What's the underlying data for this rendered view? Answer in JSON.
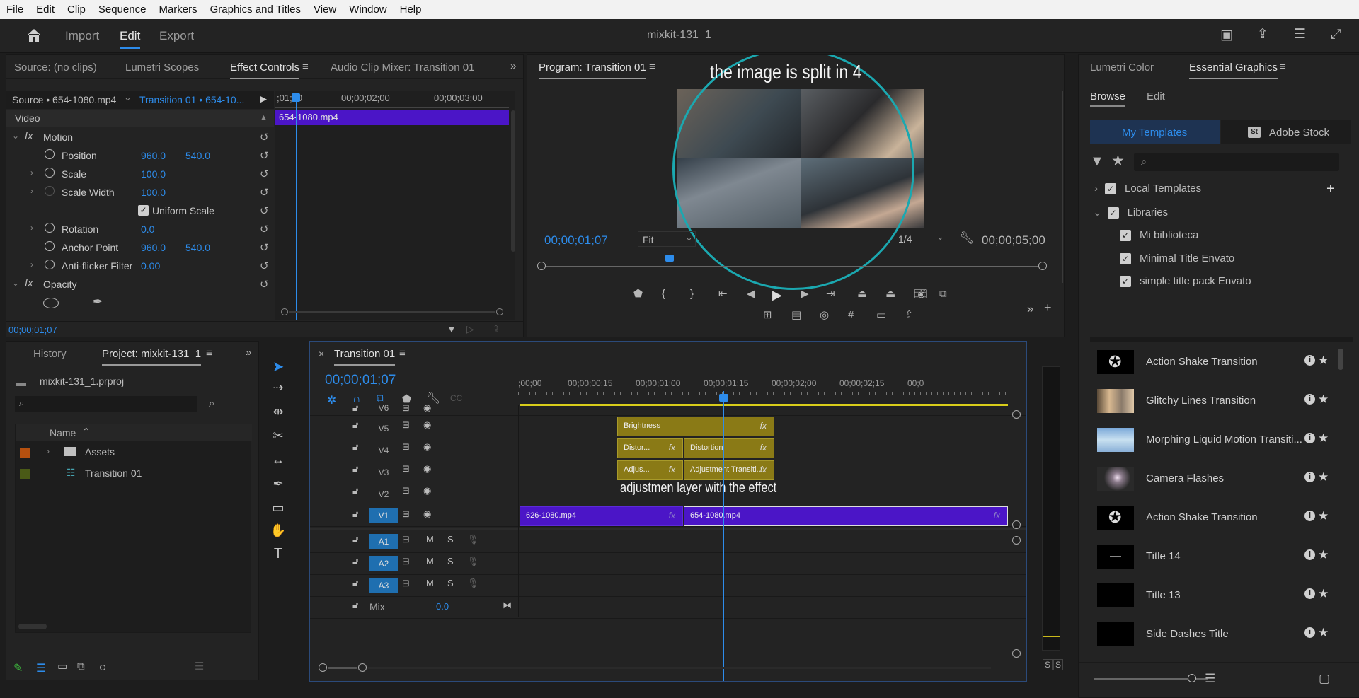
{
  "menu": [
    "File",
    "Edit",
    "Clip",
    "Sequence",
    "Markers",
    "Graphics and Titles",
    "View",
    "Window",
    "Help"
  ],
  "header": {
    "workspaces": [
      "Import",
      "Edit",
      "Export"
    ],
    "active_workspace": "Edit",
    "project_title": "mixkit-131_1"
  },
  "source_panel": {
    "tabs": [
      "Source: (no clips)",
      "Lumetri Scopes",
      "Effect Controls",
      "Audio Clip Mixer: Transition 01"
    ],
    "active_tab": "Effect Controls",
    "source_clip": "Source • 654-1080.mp4",
    "sequence_clip": "Transition 01 • 654-10...",
    "ruler": [
      ";01;00",
      "00;00;02;00",
      "00;00;03;00"
    ],
    "timeline_clip": "654-1080.mp4",
    "section_video": "Video",
    "motion_label": "Motion",
    "params": [
      {
        "name": "Position",
        "v1": "960.0",
        "v2": "540.0"
      },
      {
        "name": "Scale",
        "v1": "100.0",
        "v2": ""
      },
      {
        "name": "Scale Width",
        "v1": "100.0",
        "v2": ""
      },
      {
        "name": "Uniform Scale",
        "v1": "",
        "v2": ""
      },
      {
        "name": "Rotation",
        "v1": "0.0",
        "v2": ""
      },
      {
        "name": "Anchor Point",
        "v1": "960.0",
        "v2": "540.0"
      },
      {
        "name": "Anti-flicker Filter",
        "v1": "0.00",
        "v2": ""
      }
    ],
    "opacity_label": "Opacity",
    "timecode": "00;00;01;07"
  },
  "program": {
    "title": "Program: Transition 01",
    "annotation": "the image is split in 4",
    "timecode": "00;00;01;07",
    "fit": "Fit",
    "resolution": "1/4",
    "duration": "00;00;05;00"
  },
  "essential_graphics": {
    "tabs": [
      "Lumetri Color",
      "Essential Graphics"
    ],
    "active_tab": "Essential Graphics",
    "subtabs": [
      "Browse",
      "Edit"
    ],
    "buttons": [
      "My Templates",
      "Adobe Stock"
    ],
    "tree": [
      {
        "label": "Local Templates",
        "level": 0
      },
      {
        "label": "Libraries",
        "level": 0
      },
      {
        "label": "Mi biblioteca",
        "level": 1
      },
      {
        "label": "Minimal Title Envato",
        "level": 1
      },
      {
        "label": "simple title pack Envato",
        "level": 1
      }
    ],
    "items": [
      "Action Shake Transition",
      "Glitchy Lines Transition",
      "Morphing Liquid Motion Transiti...",
      "Camera Flashes",
      "Action Shake Transition",
      "Title 14",
      "Title 13",
      "Side Dashes Title"
    ]
  },
  "project_panel": {
    "tabs": [
      "History",
      "Project: mixkit-131_1"
    ],
    "active_tab": "Project: mixkit-131_1",
    "file": "mixkit-131_1.prproj",
    "column": "Name",
    "items": [
      {
        "name": "Assets",
        "color": "#b5500f"
      },
      {
        "name": "Transition 01",
        "color": "#4a5a16"
      }
    ]
  },
  "timeline": {
    "title": "Transition 01",
    "timecode": "00;00;01;07",
    "ruler": [
      ";00;00",
      "00;00;00;15",
      "00;00;01;00",
      "00;00;01;15",
      "00;00;02;00",
      "00;00;02;15",
      "00;0"
    ],
    "video_tracks": [
      "V6",
      "V5",
      "V4",
      "V3",
      "V2",
      "V1"
    ],
    "audio_tracks": [
      "A1",
      "A2",
      "A3"
    ],
    "mix_label": "Mix",
    "mix_value": "0.0",
    "clips": {
      "brightness": "Brightness",
      "distor_short": "Distor...",
      "distortion": "Distortion",
      "adjus_short": "Adjus...",
      "adjustment": "Adjustment Transiti...",
      "v1_a": "626-1080.mp4",
      "v1_b": "654-1080.mp4"
    },
    "annotation": "adjustmen layer with the effect"
  },
  "meters": {
    "labels": [
      "S",
      "S"
    ]
  }
}
